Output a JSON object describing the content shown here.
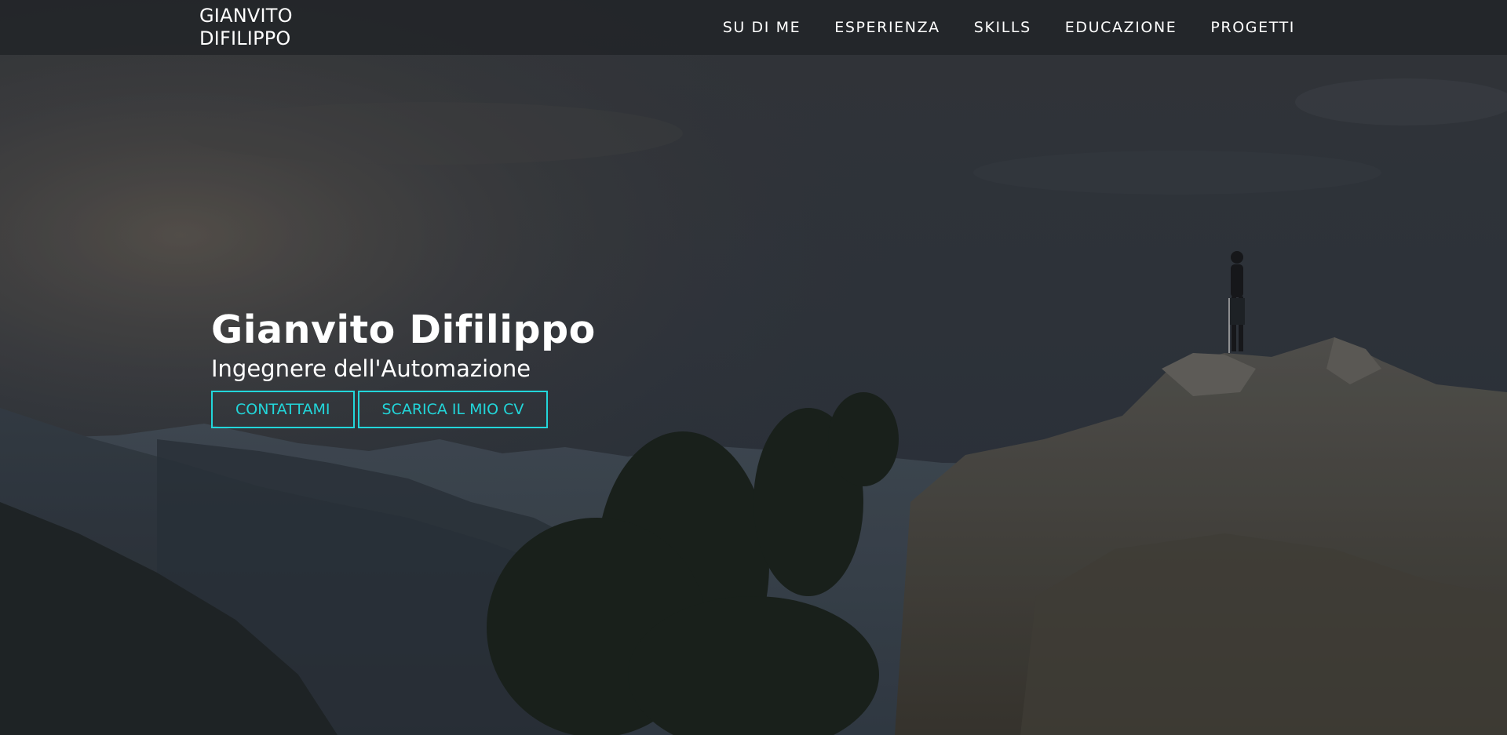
{
  "header": {
    "brand": "GIANVITO DIFILIPPO",
    "nav": [
      {
        "label": "SU DI ME"
      },
      {
        "label": "ESPERIENZA"
      },
      {
        "label": "SKILLS"
      },
      {
        "label": "EDUCAZIONE"
      },
      {
        "label": "PROGETTI"
      }
    ]
  },
  "hero": {
    "name": "Gianvito Difilippo",
    "role": "Ingegnere dell'Automazione",
    "buttons": {
      "contact": "CONTATTAMI",
      "cv": "SCARICA IL MIO CV"
    },
    "accent_color": "#22d6da",
    "background": "mountain-landscape-with-hiker-photo"
  }
}
